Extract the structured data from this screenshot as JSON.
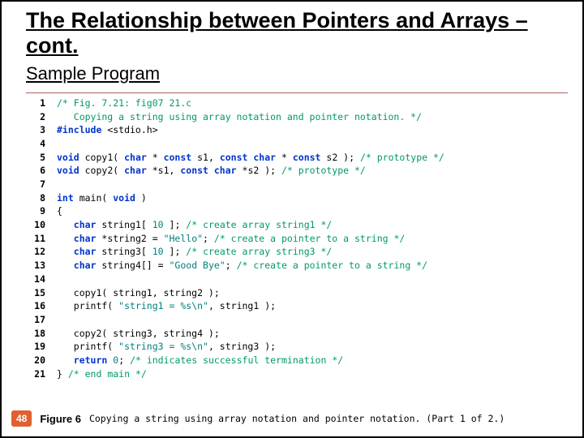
{
  "title": "The Relationship between Pointers and Arrays –cont.",
  "subtitle": "Sample Program",
  "code": [
    {
      "n": "1",
      "seg": [
        {
          "c": "c-green",
          "t": "/* Fig. 7.21: fig07 21.c"
        }
      ]
    },
    {
      "n": "2",
      "seg": [
        {
          "c": "c-green",
          "t": "   Copying a string using array notation and pointer notation. */"
        }
      ]
    },
    {
      "n": "3",
      "seg": [
        {
          "c": "c-blue",
          "t": "#include "
        },
        {
          "c": "",
          "t": "<stdio.h>"
        }
      ]
    },
    {
      "n": "4",
      "seg": []
    },
    {
      "n": "5",
      "seg": [
        {
          "c": "c-blue",
          "t": "void"
        },
        {
          "c": "",
          "t": " copy1( "
        },
        {
          "c": "c-blue",
          "t": "char"
        },
        {
          "c": "",
          "t": " * "
        },
        {
          "c": "c-blue",
          "t": "const"
        },
        {
          "c": "",
          "t": " s1, "
        },
        {
          "c": "c-blue",
          "t": "const char"
        },
        {
          "c": "",
          "t": " * "
        },
        {
          "c": "c-blue",
          "t": "const"
        },
        {
          "c": "",
          "t": " s2 ); "
        },
        {
          "c": "c-green",
          "t": "/* prototype */"
        }
      ]
    },
    {
      "n": "6",
      "seg": [
        {
          "c": "c-blue",
          "t": "void"
        },
        {
          "c": "",
          "t": " copy2( "
        },
        {
          "c": "c-blue",
          "t": "char"
        },
        {
          "c": "",
          "t": " *s1, "
        },
        {
          "c": "c-blue",
          "t": "const char"
        },
        {
          "c": "",
          "t": " *s2 ); "
        },
        {
          "c": "c-green",
          "t": "/* prototype */"
        }
      ]
    },
    {
      "n": "7",
      "seg": []
    },
    {
      "n": "8",
      "seg": [
        {
          "c": "c-blue",
          "t": "int"
        },
        {
          "c": "",
          "t": " main( "
        },
        {
          "c": "c-blue",
          "t": "void"
        },
        {
          "c": "",
          "t": " )"
        }
      ]
    },
    {
      "n": "9",
      "seg": [
        {
          "c": "",
          "t": "{"
        }
      ]
    },
    {
      "n": "10",
      "seg": [
        {
          "c": "",
          "t": "   "
        },
        {
          "c": "c-blue",
          "t": "char"
        },
        {
          "c": "",
          "t": " string1[ "
        },
        {
          "c": "c-teal",
          "t": "10"
        },
        {
          "c": "",
          "t": " ]; "
        },
        {
          "c": "c-green",
          "t": "/* create array string1 */"
        }
      ]
    },
    {
      "n": "11",
      "seg": [
        {
          "c": "",
          "t": "   "
        },
        {
          "c": "c-blue",
          "t": "char"
        },
        {
          "c": "",
          "t": " *string2 = "
        },
        {
          "c": "c-teal",
          "t": "\"Hello\""
        },
        {
          "c": "",
          "t": "; "
        },
        {
          "c": "c-green",
          "t": "/* create a pointer to a string */"
        }
      ]
    },
    {
      "n": "12",
      "seg": [
        {
          "c": "",
          "t": "   "
        },
        {
          "c": "c-blue",
          "t": "char"
        },
        {
          "c": "",
          "t": " string3[ "
        },
        {
          "c": "c-teal",
          "t": "10"
        },
        {
          "c": "",
          "t": " ]; "
        },
        {
          "c": "c-green",
          "t": "/* create array string3 */"
        }
      ]
    },
    {
      "n": "13",
      "seg": [
        {
          "c": "",
          "t": "   "
        },
        {
          "c": "c-blue",
          "t": "char"
        },
        {
          "c": "",
          "t": " string4[] = "
        },
        {
          "c": "c-teal",
          "t": "\"Good Bye\""
        },
        {
          "c": "",
          "t": "; "
        },
        {
          "c": "c-green",
          "t": "/* create a pointer to a string */"
        }
      ]
    },
    {
      "n": "14",
      "seg": []
    },
    {
      "n": "15",
      "seg": [
        {
          "c": "",
          "t": "   copy1( string1, string2 );"
        }
      ]
    },
    {
      "n": "16",
      "seg": [
        {
          "c": "",
          "t": "   printf( "
        },
        {
          "c": "c-teal",
          "t": "\"string1 = %s\\n\""
        },
        {
          "c": "",
          "t": ", string1 );"
        }
      ]
    },
    {
      "n": "17",
      "seg": []
    },
    {
      "n": "18",
      "seg": [
        {
          "c": "",
          "t": "   copy2( string3, string4 );"
        }
      ]
    },
    {
      "n": "19",
      "seg": [
        {
          "c": "",
          "t": "   printf( "
        },
        {
          "c": "c-teal",
          "t": "\"string3 = %s\\n\""
        },
        {
          "c": "",
          "t": ", string3 );"
        }
      ]
    },
    {
      "n": "20",
      "seg": [
        {
          "c": "",
          "t": "   "
        },
        {
          "c": "c-blue",
          "t": "return"
        },
        {
          "c": "",
          "t": " "
        },
        {
          "c": "c-teal",
          "t": "0"
        },
        {
          "c": "",
          "t": "; "
        },
        {
          "c": "c-green",
          "t": "/* indicates successful termination */"
        }
      ]
    },
    {
      "n": "21",
      "seg": [
        {
          "c": "",
          "t": "} "
        },
        {
          "c": "c-green",
          "t": "/* end main */"
        }
      ]
    }
  ],
  "footer": {
    "slideNum": "48",
    "figLabel": "Figure 6",
    "caption": "Copying a string using array notation and pointer notation. (Part 1 of 2.)"
  }
}
